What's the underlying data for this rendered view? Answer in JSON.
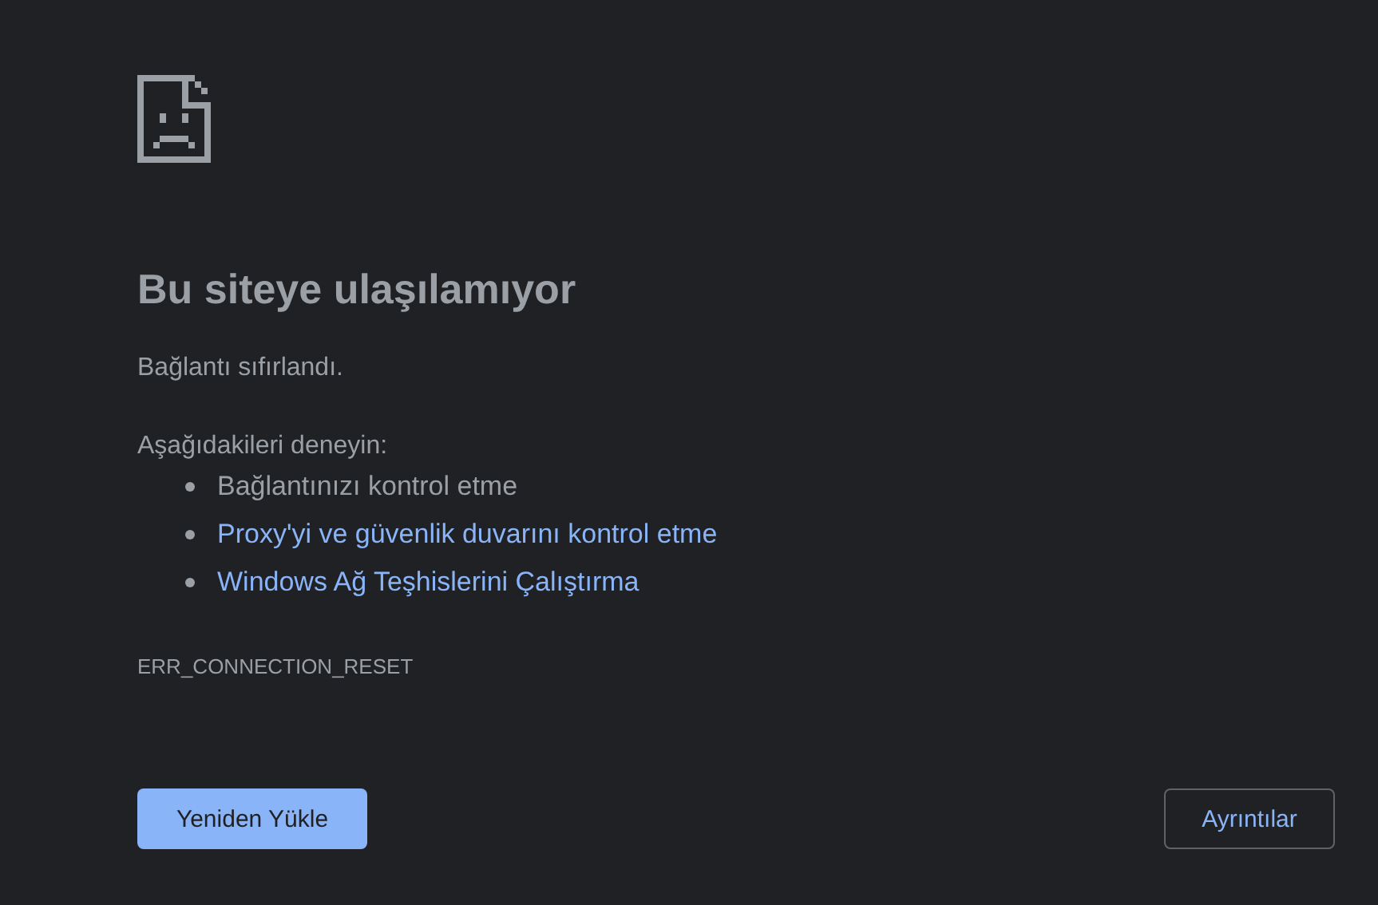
{
  "title": "Bu siteye ulaşılamıyor",
  "message": "Bağlantı sıfırlandı.",
  "suggestions_heading": "Aşağıdakileri deneyin:",
  "suggestions": [
    {
      "kind": "text",
      "text": "Bağlantınızı kontrol etme"
    },
    {
      "kind": "link",
      "text": "Proxy'yi ve güvenlik duvarını kontrol etme"
    },
    {
      "kind": "link",
      "text": "Windows Ağ Teşhislerini Çalıştırma"
    }
  ],
  "error_code": "ERR_CONNECTION_RESET",
  "buttons": {
    "reload": "Yeniden Yükle",
    "details": "Ayrıntılar"
  }
}
